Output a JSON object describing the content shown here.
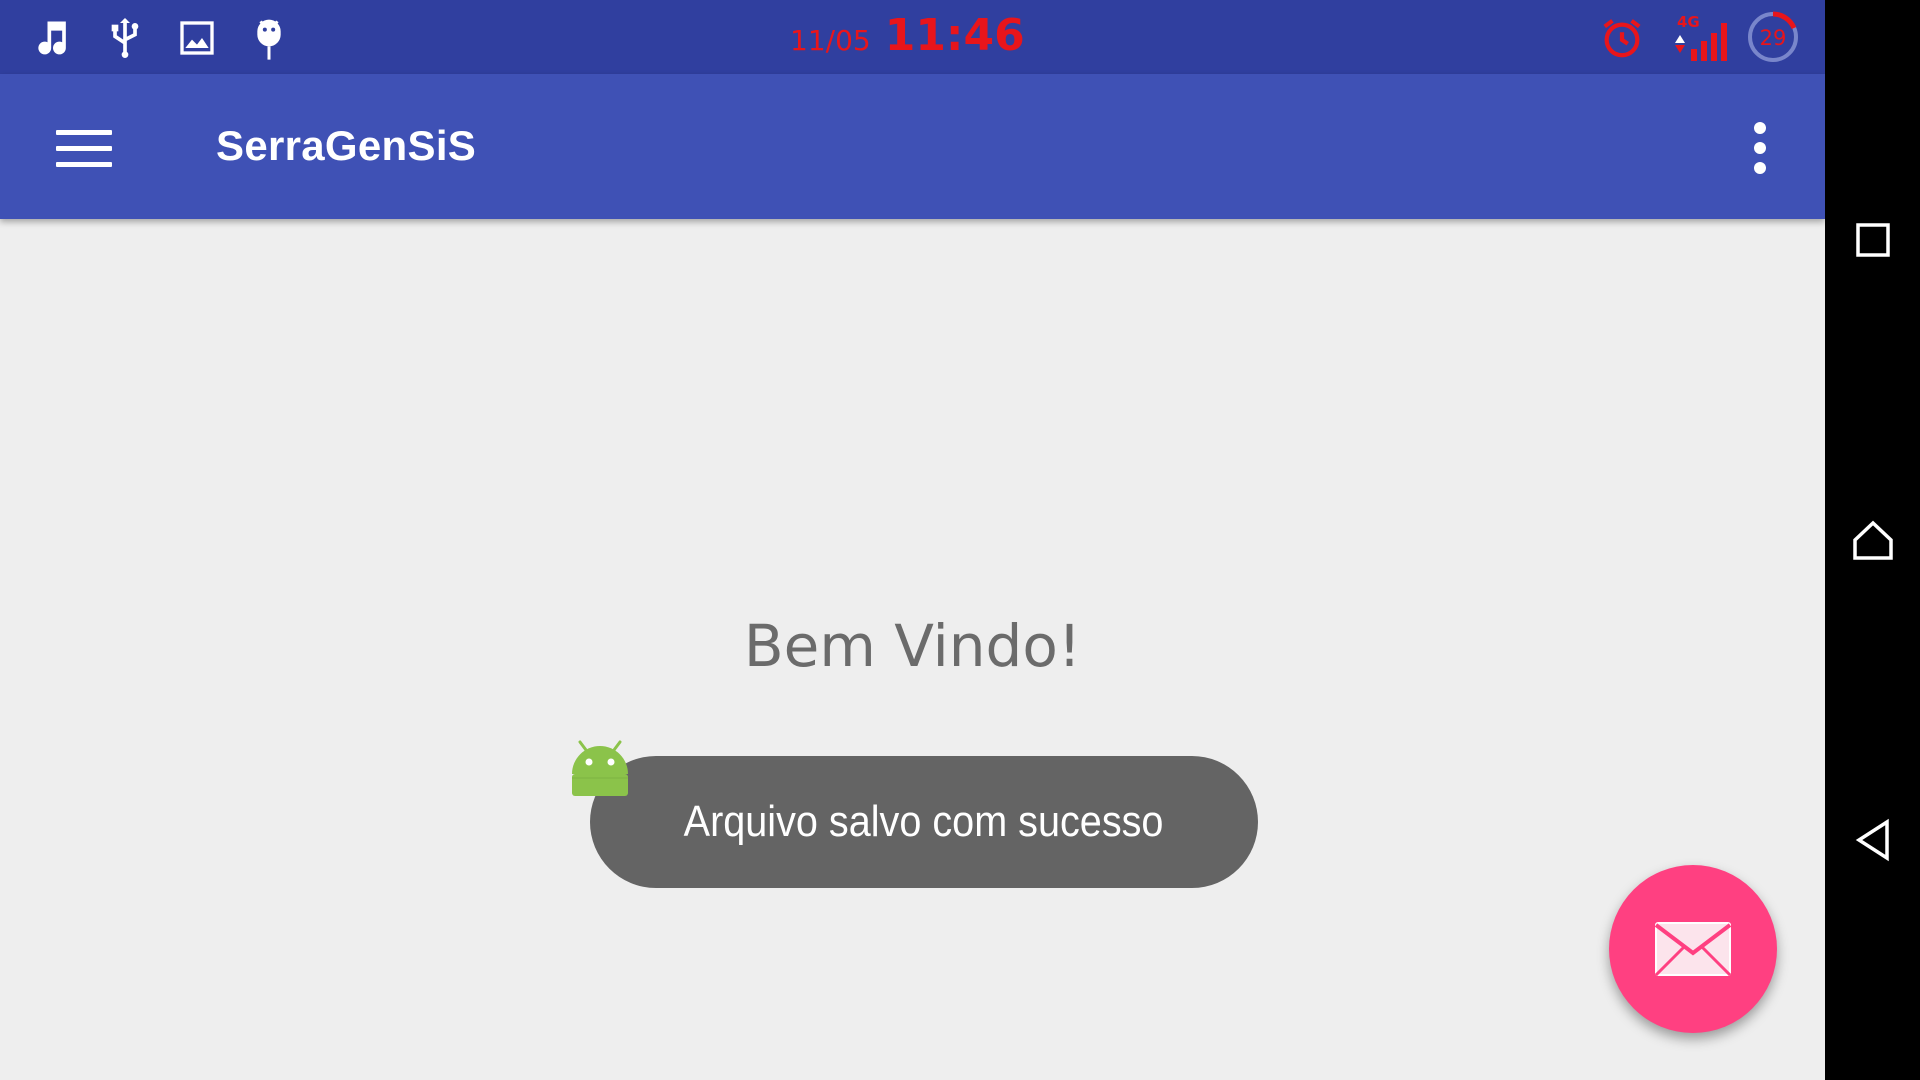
{
  "status_bar": {
    "icons": [
      "music-note-icon",
      "usb-icon",
      "image-icon",
      "android-debug-icon"
    ],
    "date": "11/05",
    "time": "11:46",
    "right_icons": [
      "alarm-icon",
      "signal-4g-icon",
      "battery-circle-icon"
    ],
    "network_label": "4G",
    "battery_level": "29",
    "clock_color": "#e8151b",
    "background_color": "#303f9f"
  },
  "app_bar": {
    "title": "SerraGenSiS",
    "menu_icon": "hamburger-menu-icon",
    "overflow_icon": "more-vert-icon",
    "background_color": "#3f51b5"
  },
  "content": {
    "welcome_text": "Bem Vindo!"
  },
  "toast": {
    "message": "Arquivo salvo com sucesso",
    "app_icon": "android-icon"
  },
  "fab": {
    "icon": "mail-icon",
    "color": "#ff4081"
  },
  "nav_bar": {
    "buttons": [
      "recents-icon",
      "home-icon",
      "back-icon"
    ]
  }
}
